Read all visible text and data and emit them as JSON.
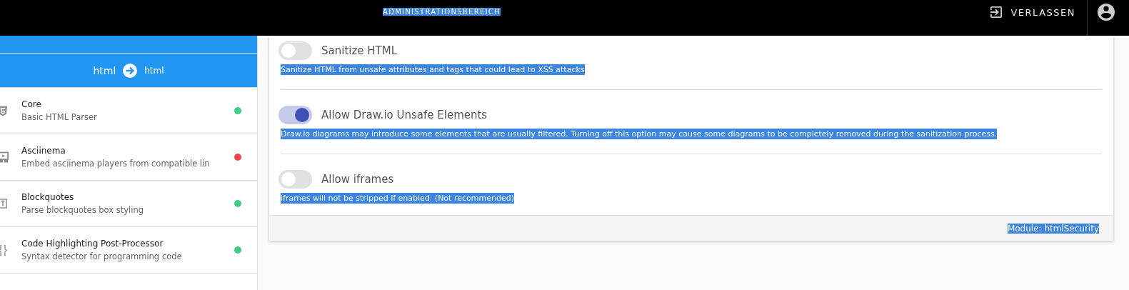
{
  "header": {
    "title": "ADMINISTRATIONSBEREICH",
    "title_highlighted": true,
    "exit_label": "VERLASSEN"
  },
  "sidebar": {
    "items": [
      {
        "kind": "conversion"
      },
      {
        "kind": "conversion",
        "from": "html",
        "to": "html"
      },
      {
        "kind": "module",
        "title": "Core",
        "subtitle": "Basic HTML Parser",
        "color": "#3ccf85"
      },
      {
        "kind": "module",
        "title": "Asciinema",
        "subtitle": "Embed asciinema players from compatible lin",
        "color": "#f44646"
      },
      {
        "kind": "module",
        "title": "Blockquotes",
        "subtitle": "Parse blockquotes box styling",
        "color": "#3ccf85"
      },
      {
        "kind": "module",
        "title": "Code Highlighting Post-Processor",
        "subtitle": "Syntax detector for programming code",
        "color": "#3ccf85"
      }
    ]
  },
  "settings": [
    {
      "label": "Sanitize HTML",
      "on": false,
      "description": "Sanitize HTML from unsafe attributes and tags that could lead to XSS attacks",
      "highlighted": true
    },
    {
      "label": "Allow Draw.io Unsafe Elements",
      "on": true,
      "description": "Draw.io diagrams may introduce some elements that are usually filtered. Turning off this option may cause some diagrams to be completely removed during the sanitization process.",
      "highlighted": true
    },
    {
      "label": "Allow iframes",
      "on": false,
      "description": "iframes will not be stripped if enabled. (Not recommended)",
      "highlighted": true
    }
  ],
  "footer": {
    "text": "Module: htmlSecurity",
    "highlighted": true
  }
}
